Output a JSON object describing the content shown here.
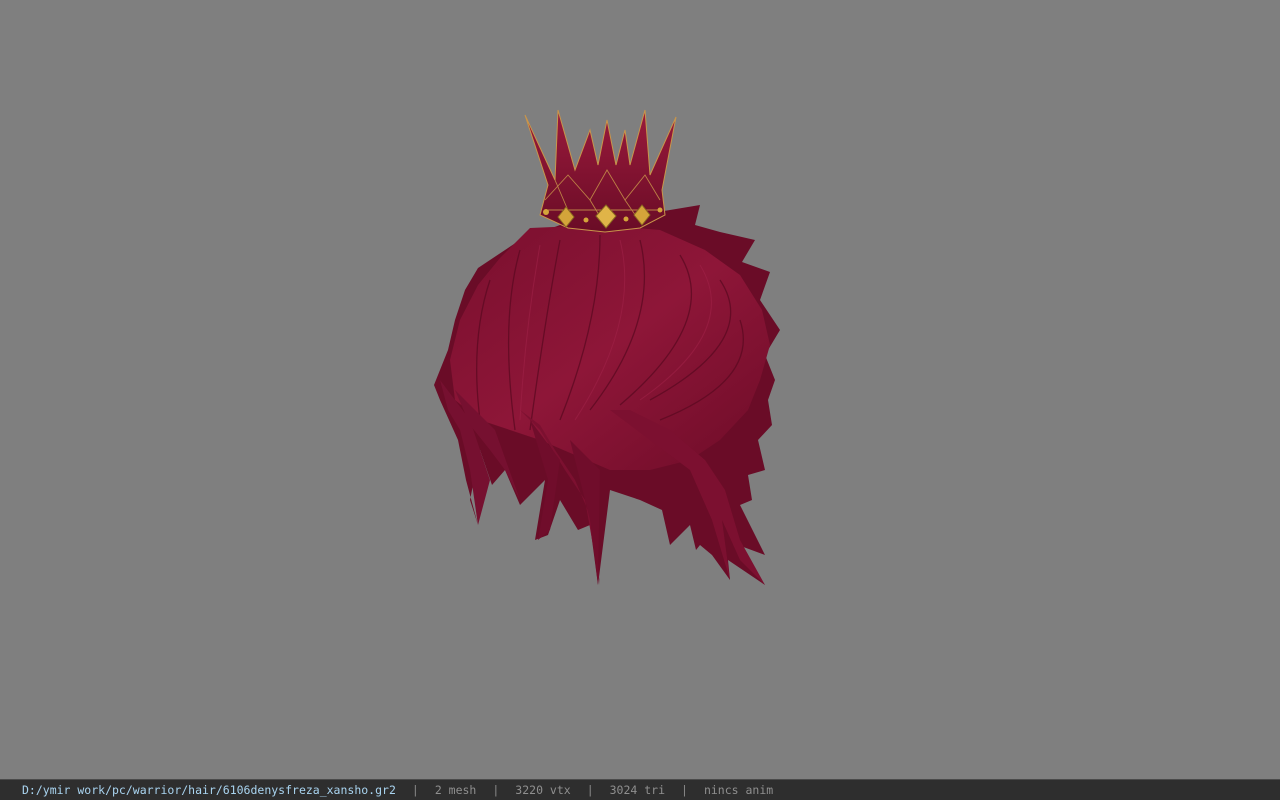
{
  "viewport": {
    "background_color": "#7f7f7f",
    "model": {
      "description_icon": "crown-hair-model",
      "hair_color": "#8a1235",
      "crown_color": "#7f1030",
      "gem_color": "#d4a43a"
    }
  },
  "statusbar": {
    "file_path": "D:/ymir work/pc/warrior/hair/6106denysfreza_xansho.gr2",
    "separator": "|",
    "mesh_count": "2 mesh",
    "vertex_count": "3220 vtx",
    "triangle_count": "3024 tri",
    "animation_status": "nincs anim",
    "path_color": "#a9d4f0"
  }
}
